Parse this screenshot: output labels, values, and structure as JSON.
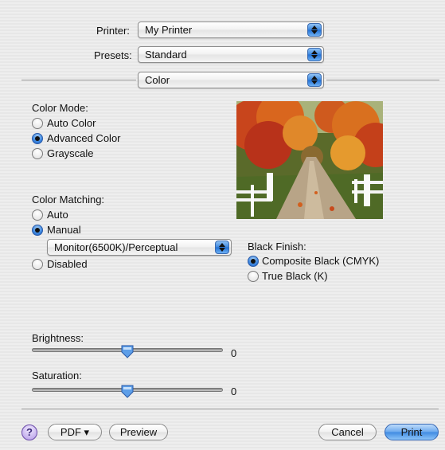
{
  "printer": {
    "label": "Printer:",
    "value": "My Printer"
  },
  "presets": {
    "label": "Presets:",
    "value": "Standard"
  },
  "panel": {
    "value": "Color"
  },
  "color_mode": {
    "label": "Color Mode:",
    "options": [
      "Auto Color",
      "Advanced Color",
      "Grayscale"
    ],
    "selected": "Advanced Color"
  },
  "color_matching": {
    "label": "Color Matching:",
    "options": [
      "Auto",
      "Manual",
      "Disabled"
    ],
    "selected": "Manual",
    "profile": "Monitor(6500K)/Perceptual"
  },
  "black_finish": {
    "label": "Black Finish:",
    "options": [
      "Composite Black (CMYK)",
      "True Black (K)"
    ],
    "selected": "Composite Black (CMYK)"
  },
  "brightness": {
    "label": "Brightness:",
    "value": "0",
    "level": 0.5
  },
  "saturation": {
    "label": "Saturation:",
    "value": "0",
    "level": 0.5
  },
  "buttons": {
    "help": "?",
    "pdf": "PDF ▾",
    "preview": "Preview",
    "cancel": "Cancel",
    "print": "Print"
  },
  "colors": {
    "accent": "#3c86de",
    "default_button": "#6aa8ee"
  }
}
